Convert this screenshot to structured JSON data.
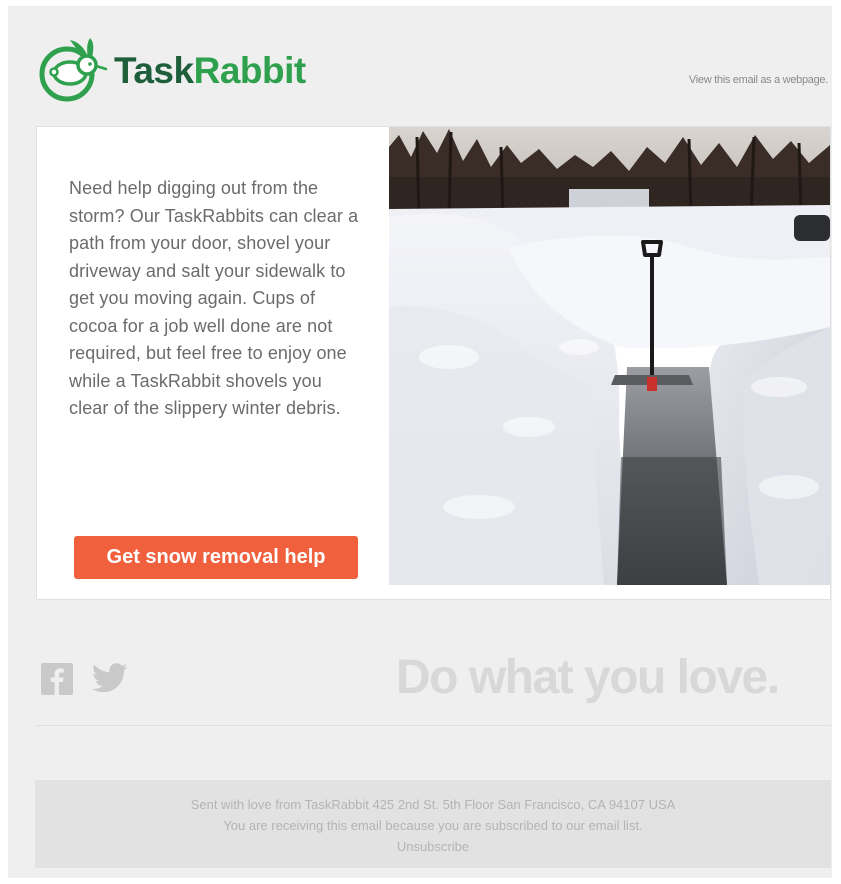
{
  "header": {
    "logo_task": "Task",
    "logo_rabbit": "Rabbit",
    "view_webpage": "View this email as a webpage."
  },
  "card": {
    "body_text": "Need help digging out from the storm? Our TaskRabbits can clear a path from your door, shovel your driveway and salt your sidewalk to get you moving again. Cups of cocoa for a job well done are not required, but feel free to enjoy one while a TaskRabbit shovels you clear of the slippery winter debris.",
    "cta_label": "Get snow removal help"
  },
  "social": {
    "icons": [
      "facebook-icon",
      "twitter-icon"
    ]
  },
  "tagline": "Do what you love.",
  "footer": {
    "address_line": "Sent with love from TaskRabbit 425 2nd St. 5th Floor San Francisco, CA 94107 USA",
    "subscription_line": "You are receiving this email because you are subscribed to our email list.",
    "unsubscribe_label": "Unsubscribe"
  },
  "colors": {
    "brand_dark_green": "#1f5e3b",
    "brand_green": "#2fa14e",
    "cta_orange": "#f0603d",
    "background": "#efefef"
  }
}
